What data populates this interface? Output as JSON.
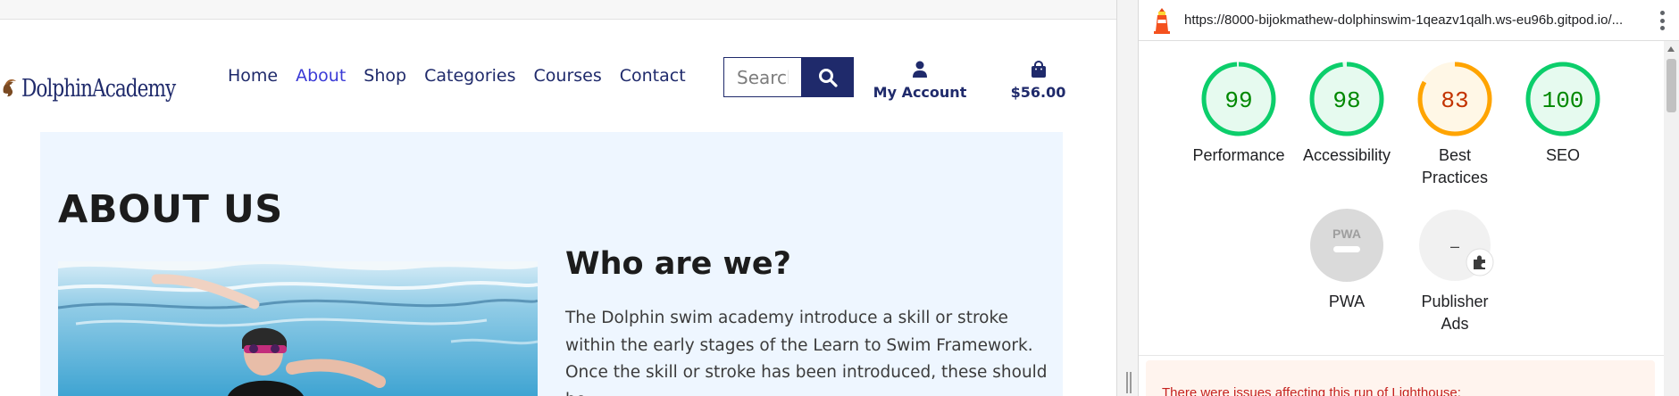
{
  "site": {
    "logo_text": "DolphinAcademy",
    "nav": [
      {
        "label": "Home",
        "active": false
      },
      {
        "label": "About",
        "active": true
      },
      {
        "label": "Shop",
        "active": false
      },
      {
        "label": "Categories",
        "active": false
      },
      {
        "label": "Courses",
        "active": false
      },
      {
        "label": "Contact",
        "active": false
      }
    ],
    "search": {
      "placeholder": "Search"
    },
    "account_label": "My Account",
    "cart_total": "$56.00",
    "page_title": "ABOUT US",
    "section_heading": "Who are we?",
    "section_body": "The Dolphin swim academy introduce a skill or stroke within the early stages of the Learn to Swim Framework. Once the skill or stroke has been introduced, these should be",
    "colors": {
      "brand": "#1f2a6b",
      "active_link": "#3a3ad6",
      "section_bg": "#eef6ff"
    }
  },
  "lighthouse": {
    "url": "https://8000-bijokmathew-dolphinswim-1qeazv1qalh.ws-eu96b.gitpod.io/...",
    "scores": [
      {
        "label": "Performance",
        "score": 99,
        "color": "#0cce6b",
        "text_color": "#008800",
        "bg": "#e6faef"
      },
      {
        "label": "Accessibility",
        "score": 98,
        "color": "#0cce6b",
        "text_color": "#008800",
        "bg": "#e6faef"
      },
      {
        "label": "Best Practices",
        "score": 83,
        "color": "#ffa400",
        "text_color": "#c33300",
        "bg": "#fff7e6"
      },
      {
        "label": "SEO",
        "score": 100,
        "color": "#0cce6b",
        "text_color": "#008800",
        "bg": "#e6faef"
      }
    ],
    "pwa": {
      "label": "PWA",
      "badge_text": "PWA"
    },
    "publisher_ads": {
      "label": "Publisher Ads",
      "score_text": "–"
    },
    "warning_text": "There were issues affecting this run of Lighthouse:"
  }
}
